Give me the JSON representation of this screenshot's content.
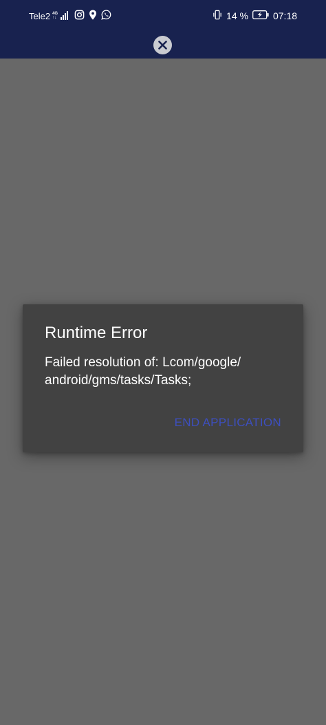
{
  "status_bar": {
    "carrier": "Tele2",
    "network_type": "4G",
    "network_sub": "↑↓",
    "battery_percent": "14 %",
    "time": "07:18",
    "icons": [
      "signal-icon",
      "instagram-icon",
      "location-icon",
      "whatsapp-icon",
      "vibrate-icon",
      "battery-charging-icon"
    ]
  },
  "app_bar": {
    "close_icon": "close-icon"
  },
  "dialog": {
    "title": "Runtime Error",
    "message_line1": "Failed resolution of: Lcom/google/",
    "message_line2": "android/gms/tasks/Tasks;",
    "button_label": "END APPLICATION"
  },
  "colors": {
    "status_bar_bg": "#18224f",
    "scrim_bg": "#686868",
    "dialog_bg": "#424242",
    "accent": "#3d4fbf"
  }
}
